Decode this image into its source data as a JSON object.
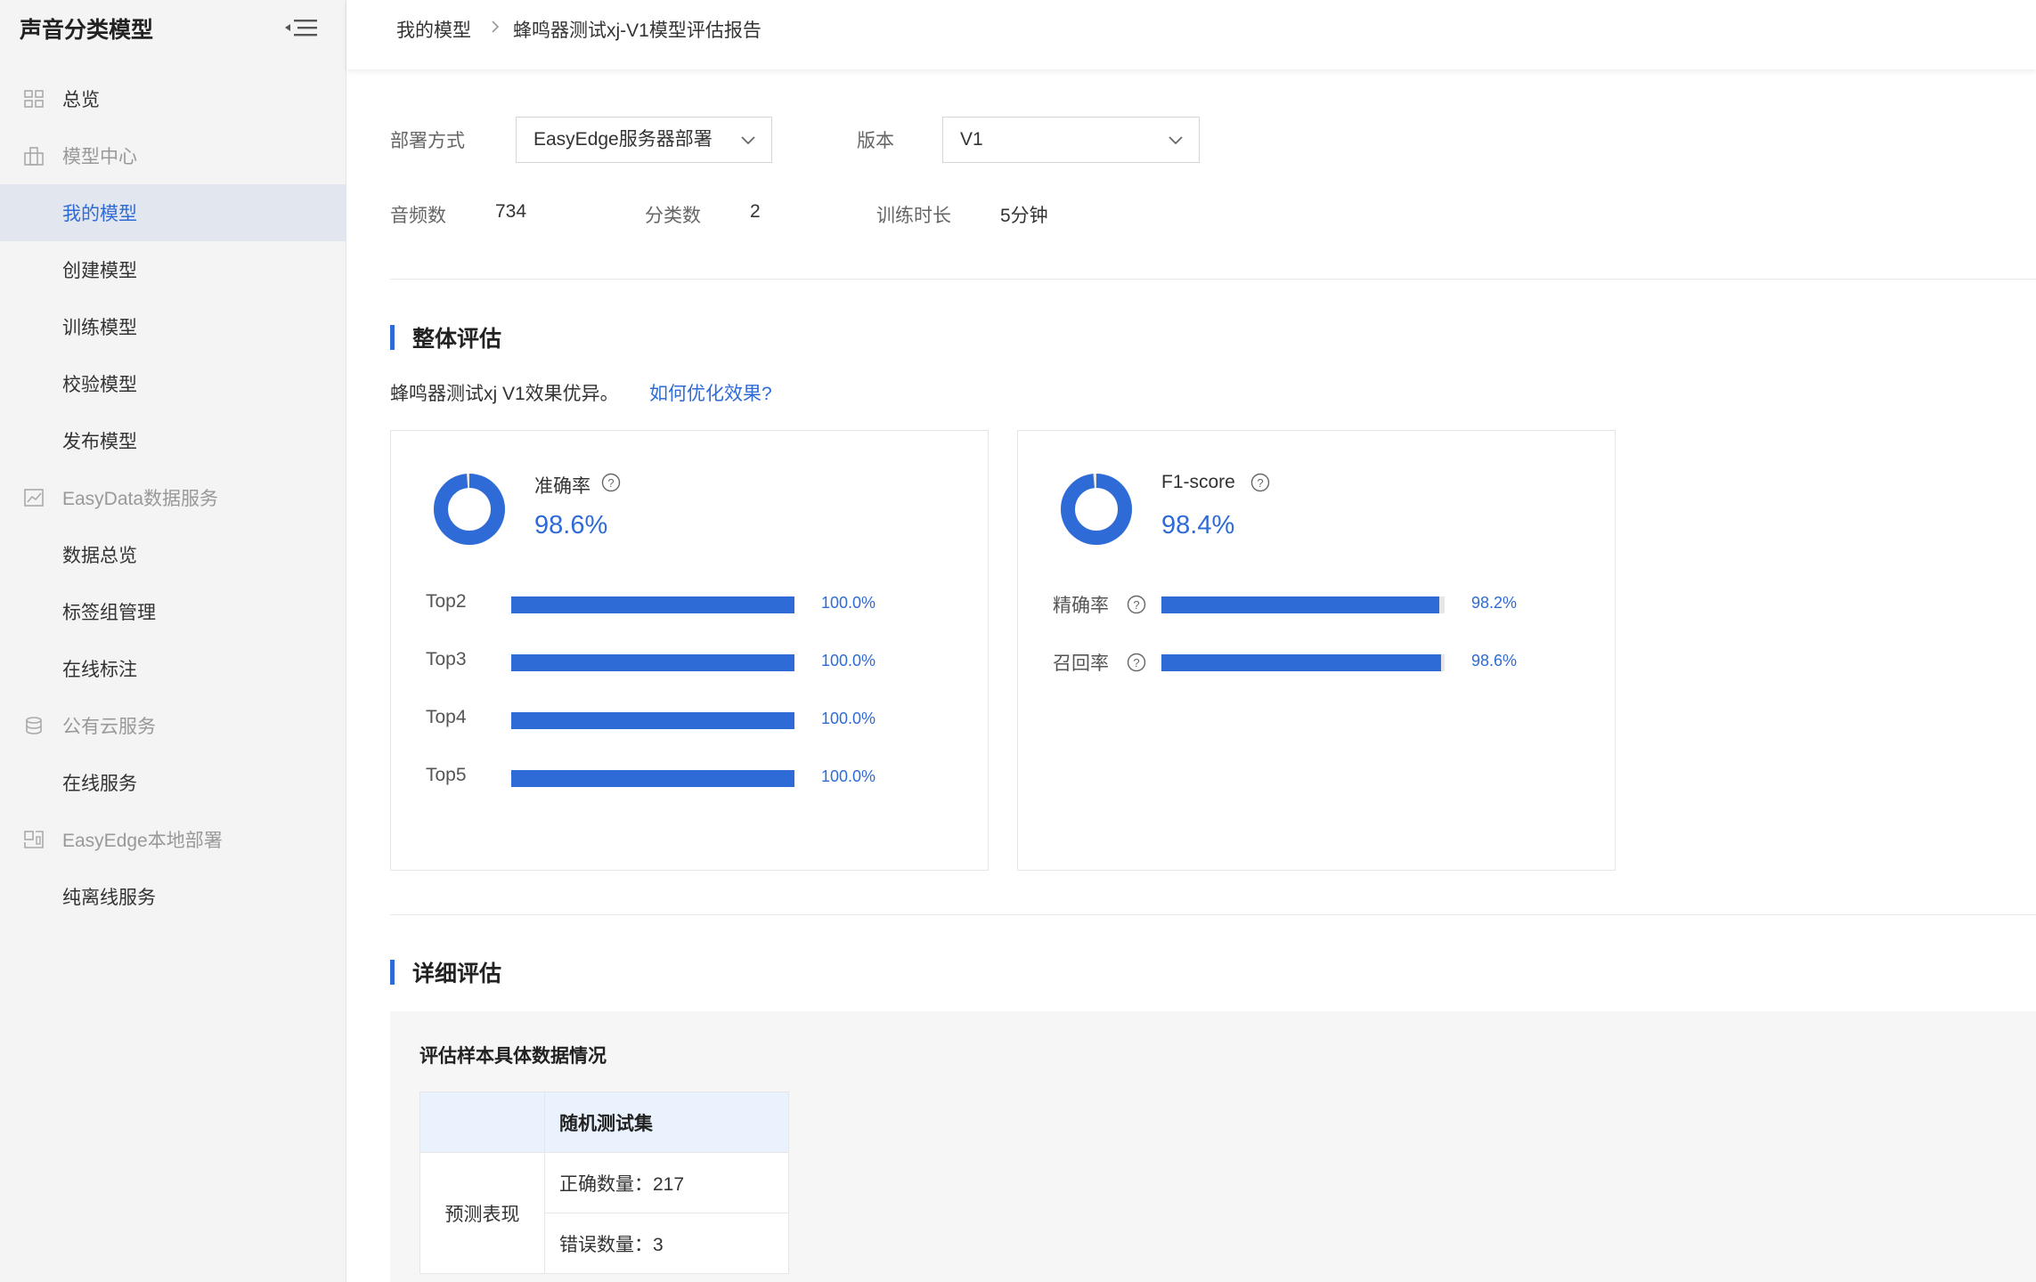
{
  "app": {
    "title": "声音分类模型"
  },
  "sidebar": {
    "items": [
      {
        "label": "总览",
        "type": "group",
        "icon": "grid-icon"
      },
      {
        "label": "模型中心",
        "type": "group",
        "icon": "building-icon"
      },
      {
        "label": "我的模型",
        "type": "child",
        "active": true
      },
      {
        "label": "创建模型",
        "type": "child"
      },
      {
        "label": "训练模型",
        "type": "child"
      },
      {
        "label": "校验模型",
        "type": "child"
      },
      {
        "label": "发布模型",
        "type": "child"
      },
      {
        "label": "EasyData数据服务",
        "type": "group",
        "icon": "chart-icon"
      },
      {
        "label": "数据总览",
        "type": "child"
      },
      {
        "label": "标签组管理",
        "type": "child"
      },
      {
        "label": "在线标注",
        "type": "child"
      },
      {
        "label": "公有云服务",
        "type": "group",
        "icon": "database-icon"
      },
      {
        "label": "在线服务",
        "type": "child"
      },
      {
        "label": "EasyEdge本地部署",
        "type": "group",
        "icon": "device-icon"
      },
      {
        "label": "纯离线服务",
        "type": "child"
      }
    ]
  },
  "breadcrumb": {
    "parent": "我的模型",
    "current": "蜂鸣器测试xj-V1模型评估报告"
  },
  "filters": {
    "deploy_label": "部署方式",
    "deploy_value": "EasyEdge服务器部署",
    "version_label": "版本",
    "version_value": "V1"
  },
  "stats": {
    "audio_label": "音频数",
    "audio_value": "734",
    "class_label": "分类数",
    "class_value": "2",
    "time_label": "训练时长",
    "time_value": "5分钟"
  },
  "overall": {
    "title": "整体评估",
    "summary": "蜂鸣器测试xj V1效果优异。",
    "link": "如何优化效果?",
    "accuracy": {
      "name": "准确率",
      "value_text": "98.6%",
      "value": 0.986,
      "bars": [
        {
          "label": "Top2",
          "value": 1.0,
          "text": "100.0%"
        },
        {
          "label": "Top3",
          "value": 1.0,
          "text": "100.0%"
        },
        {
          "label": "Top4",
          "value": 1.0,
          "text": "100.0%"
        },
        {
          "label": "Top5",
          "value": 1.0,
          "text": "100.0%"
        }
      ]
    },
    "f1": {
      "name": "F1-score",
      "value_text": "98.4%",
      "value": 0.984,
      "bars": [
        {
          "label": "精确率",
          "value": 0.982,
          "text": "98.2%"
        },
        {
          "label": "召回率",
          "value": 0.986,
          "text": "98.6%"
        }
      ]
    }
  },
  "detail": {
    "title": "详细评估",
    "heading": "评估样本具体数据情况",
    "table": {
      "column": "随机测试集",
      "row_label": "预测表现",
      "correct": "正确数量：217",
      "wrong": "错误数量：3"
    }
  },
  "colors": {
    "accent": "#2f6bd6",
    "track": "#e6e6e6"
  }
}
